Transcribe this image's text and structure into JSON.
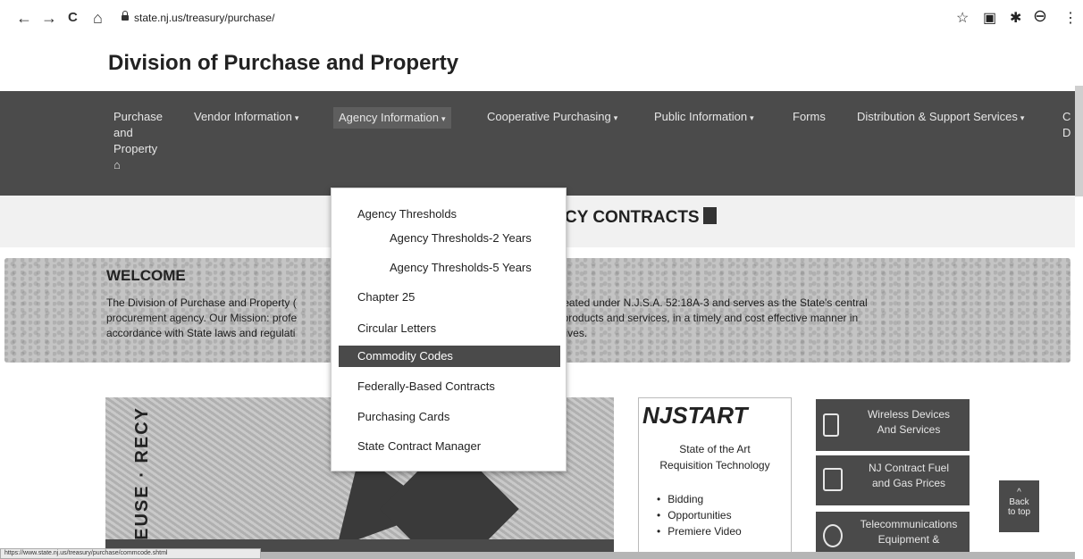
{
  "browser": {
    "url": "state.nj.us/treasury/purchase/",
    "back_icon": "←",
    "forward_icon": "→",
    "reload_icon": "C",
    "home_icon": "⌂",
    "star_icon": "☆",
    "ext_icon": "▣",
    "pin_icon": "✱",
    "account_icon": "⊖",
    "menu_icon": "⋮"
  },
  "site": {
    "title": "Division of Purchase and Property"
  },
  "nav": {
    "home_label_line1": "Purchase",
    "home_label_line2": "and",
    "home_label_line3": "Property",
    "home_icon": "⌂",
    "caret": "▾",
    "items": [
      "Vendor Information",
      "Agency Information",
      "Cooperative Purchasing",
      "Public Information",
      "Forms",
      "Distribution & Support Services"
    ],
    "cut_line1": "C",
    "cut_line2": "D"
  },
  "dropdown": {
    "items": [
      "Agency Thresholds",
      "Agency Thresholds-2 Years",
      "Agency Thresholds-5 Years",
      "Chapter 25",
      "Circular Letters",
      "Commodity Codes",
      "Federally-Based Contracts",
      "Purchasing Cards",
      "State Contract Manager"
    ]
  },
  "page": {
    "contracts_heading": "CY CONTRACTS"
  },
  "welcome": {
    "heading": "WELCOME",
    "line1_a": "The Division of Purchase and Property (",
    "line1_b": "y, was created under N.J.S.A. 52:18A-3 and serves as the State's central",
    "line2_a": "procurement agency. Our Mission: profe",
    "line2_b": "ued products and services, in a timely and cost effective manner in",
    "line3_a": "accordance with State laws and regulati",
    "line3_b": "objectives."
  },
  "recycle": {
    "vertical_text": "EUSE · RECY"
  },
  "njstart": {
    "logo": "NJSTART",
    "subtitle_line1": "State of the Art",
    "subtitle_line2": "Requisition Technology",
    "bullets": [
      "Bidding",
      "Opportunities",
      "Premiere Video"
    ]
  },
  "side_buttons": [
    {
      "line1": "Wireless Devices",
      "line2": "And Services",
      "icon": "phone-icon"
    },
    {
      "line1": "NJ Contract Fuel",
      "line2": "and Gas Prices",
      "icon": "fuel-icon"
    },
    {
      "line1": "Telecommunications",
      "line2": "Equipment &",
      "icon": "antenna-icon"
    }
  ],
  "back_to_top": {
    "arrow": "^",
    "line1": "Back",
    "line2": "to top"
  },
  "status_url": "https://www.state.nj.us/treasury/purchase/commcode.shtml",
  "colors": {
    "nav_bg": "#4b4b4b",
    "highlight": "#4a4a4a",
    "dropdown_bg": "#ffffff"
  }
}
